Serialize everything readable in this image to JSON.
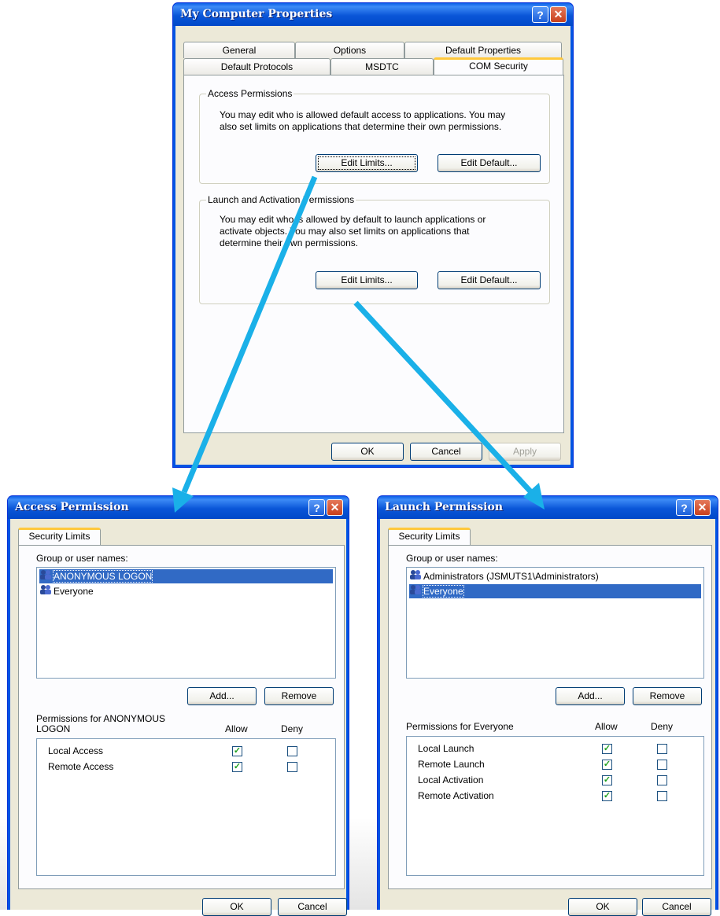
{
  "main_dialog": {
    "title": "My Computer Properties",
    "tabs_row1": [
      "General",
      "Options",
      "Default Properties"
    ],
    "tabs_row2": [
      "Default Protocols",
      "MSDTC",
      "COM Security"
    ],
    "access_group": {
      "legend": "Access Permissions",
      "description_line1": "You may edit who is allowed default access to applications. You may",
      "description_line2": "also set limits on applications that determine their own permissions.",
      "edit_limits": "Edit Limits...",
      "edit_default": "Edit Default..."
    },
    "launch_group": {
      "legend": "Launch and Activation Permissions",
      "description_line1": "You may edit who is allowed by default to launch applications or",
      "description_line2": "activate objects. You may also set limits on applications that",
      "description_line3": "determine their own permissions.",
      "edit_limits": "Edit Limits...",
      "edit_default": "Edit Default..."
    },
    "ok": "OK",
    "cancel": "Cancel",
    "apply": "Apply"
  },
  "access_dialog": {
    "title": "Access Permission",
    "tab": "Security Limits",
    "group_label": "Group or user names:",
    "users": [
      "ANONYMOUS LOGON",
      "Everyone"
    ],
    "selected_user": "ANONYMOUS LOGON",
    "add": "Add...",
    "remove": "Remove",
    "perm_label_line1": "Permissions for ANONYMOUS",
    "perm_label_line2": "LOGON",
    "allow": "Allow",
    "deny": "Deny",
    "permissions": [
      {
        "name": "Local Access",
        "allow": true,
        "deny": false
      },
      {
        "name": "Remote Access",
        "allow": true,
        "deny": false
      }
    ],
    "ok": "OK",
    "cancel": "Cancel"
  },
  "launch_dialog": {
    "title": "Launch Permission",
    "tab": "Security Limits",
    "group_label": "Group or user names:",
    "users": [
      "Administrators (JSMUTS1\\Administrators)",
      "Everyone"
    ],
    "selected_user": "Everyone",
    "add": "Add...",
    "remove": "Remove",
    "perm_label": "Permissions for Everyone",
    "allow": "Allow",
    "deny": "Deny",
    "permissions": [
      {
        "name": "Local Launch",
        "allow": true,
        "deny": false
      },
      {
        "name": "Remote Launch",
        "allow": true,
        "deny": false
      },
      {
        "name": "Local Activation",
        "allow": true,
        "deny": false
      },
      {
        "name": "Remote Activation",
        "allow": true,
        "deny": false
      }
    ],
    "ok": "OK",
    "cancel": "Cancel"
  },
  "colors": {
    "arrow": "#1ab0e8",
    "title_blue": "#0054e3",
    "selection": "#316ac5",
    "dialog_face": "#ece9d8"
  },
  "icons": [
    "help-icon",
    "close-icon",
    "user-group-icon",
    "checkmark-icon",
    "arrow-icon"
  ]
}
